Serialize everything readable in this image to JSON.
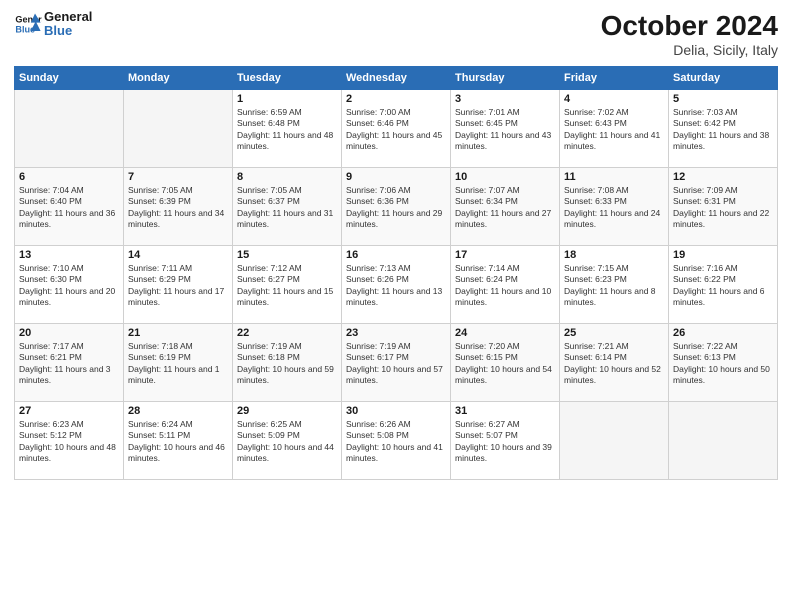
{
  "header": {
    "logo_line1": "General",
    "logo_line2": "Blue",
    "month": "October 2024",
    "location": "Delia, Sicily, Italy"
  },
  "columns": [
    "Sunday",
    "Monday",
    "Tuesday",
    "Wednesday",
    "Thursday",
    "Friday",
    "Saturday"
  ],
  "weeks": [
    [
      {
        "day": "",
        "content": ""
      },
      {
        "day": "",
        "content": ""
      },
      {
        "day": "1",
        "content": "Sunrise: 6:59 AM\nSunset: 6:48 PM\nDaylight: 11 hours and 48 minutes."
      },
      {
        "day": "2",
        "content": "Sunrise: 7:00 AM\nSunset: 6:46 PM\nDaylight: 11 hours and 45 minutes."
      },
      {
        "day": "3",
        "content": "Sunrise: 7:01 AM\nSunset: 6:45 PM\nDaylight: 11 hours and 43 minutes."
      },
      {
        "day": "4",
        "content": "Sunrise: 7:02 AM\nSunset: 6:43 PM\nDaylight: 11 hours and 41 minutes."
      },
      {
        "day": "5",
        "content": "Sunrise: 7:03 AM\nSunset: 6:42 PM\nDaylight: 11 hours and 38 minutes."
      }
    ],
    [
      {
        "day": "6",
        "content": "Sunrise: 7:04 AM\nSunset: 6:40 PM\nDaylight: 11 hours and 36 minutes."
      },
      {
        "day": "7",
        "content": "Sunrise: 7:05 AM\nSunset: 6:39 PM\nDaylight: 11 hours and 34 minutes."
      },
      {
        "day": "8",
        "content": "Sunrise: 7:05 AM\nSunset: 6:37 PM\nDaylight: 11 hours and 31 minutes."
      },
      {
        "day": "9",
        "content": "Sunrise: 7:06 AM\nSunset: 6:36 PM\nDaylight: 11 hours and 29 minutes."
      },
      {
        "day": "10",
        "content": "Sunrise: 7:07 AM\nSunset: 6:34 PM\nDaylight: 11 hours and 27 minutes."
      },
      {
        "day": "11",
        "content": "Sunrise: 7:08 AM\nSunset: 6:33 PM\nDaylight: 11 hours and 24 minutes."
      },
      {
        "day": "12",
        "content": "Sunrise: 7:09 AM\nSunset: 6:31 PM\nDaylight: 11 hours and 22 minutes."
      }
    ],
    [
      {
        "day": "13",
        "content": "Sunrise: 7:10 AM\nSunset: 6:30 PM\nDaylight: 11 hours and 20 minutes."
      },
      {
        "day": "14",
        "content": "Sunrise: 7:11 AM\nSunset: 6:29 PM\nDaylight: 11 hours and 17 minutes."
      },
      {
        "day": "15",
        "content": "Sunrise: 7:12 AM\nSunset: 6:27 PM\nDaylight: 11 hours and 15 minutes."
      },
      {
        "day": "16",
        "content": "Sunrise: 7:13 AM\nSunset: 6:26 PM\nDaylight: 11 hours and 13 minutes."
      },
      {
        "day": "17",
        "content": "Sunrise: 7:14 AM\nSunset: 6:24 PM\nDaylight: 11 hours and 10 minutes."
      },
      {
        "day": "18",
        "content": "Sunrise: 7:15 AM\nSunset: 6:23 PM\nDaylight: 11 hours and 8 minutes."
      },
      {
        "day": "19",
        "content": "Sunrise: 7:16 AM\nSunset: 6:22 PM\nDaylight: 11 hours and 6 minutes."
      }
    ],
    [
      {
        "day": "20",
        "content": "Sunrise: 7:17 AM\nSunset: 6:21 PM\nDaylight: 11 hours and 3 minutes."
      },
      {
        "day": "21",
        "content": "Sunrise: 7:18 AM\nSunset: 6:19 PM\nDaylight: 11 hours and 1 minute."
      },
      {
        "day": "22",
        "content": "Sunrise: 7:19 AM\nSunset: 6:18 PM\nDaylight: 10 hours and 59 minutes."
      },
      {
        "day": "23",
        "content": "Sunrise: 7:19 AM\nSunset: 6:17 PM\nDaylight: 10 hours and 57 minutes."
      },
      {
        "day": "24",
        "content": "Sunrise: 7:20 AM\nSunset: 6:15 PM\nDaylight: 10 hours and 54 minutes."
      },
      {
        "day": "25",
        "content": "Sunrise: 7:21 AM\nSunset: 6:14 PM\nDaylight: 10 hours and 52 minutes."
      },
      {
        "day": "26",
        "content": "Sunrise: 7:22 AM\nSunset: 6:13 PM\nDaylight: 10 hours and 50 minutes."
      }
    ],
    [
      {
        "day": "27",
        "content": "Sunrise: 6:23 AM\nSunset: 5:12 PM\nDaylight: 10 hours and 48 minutes."
      },
      {
        "day": "28",
        "content": "Sunrise: 6:24 AM\nSunset: 5:11 PM\nDaylight: 10 hours and 46 minutes."
      },
      {
        "day": "29",
        "content": "Sunrise: 6:25 AM\nSunset: 5:09 PM\nDaylight: 10 hours and 44 minutes."
      },
      {
        "day": "30",
        "content": "Sunrise: 6:26 AM\nSunset: 5:08 PM\nDaylight: 10 hours and 41 minutes."
      },
      {
        "day": "31",
        "content": "Sunrise: 6:27 AM\nSunset: 5:07 PM\nDaylight: 10 hours and 39 minutes."
      },
      {
        "day": "",
        "content": ""
      },
      {
        "day": "",
        "content": ""
      }
    ]
  ]
}
